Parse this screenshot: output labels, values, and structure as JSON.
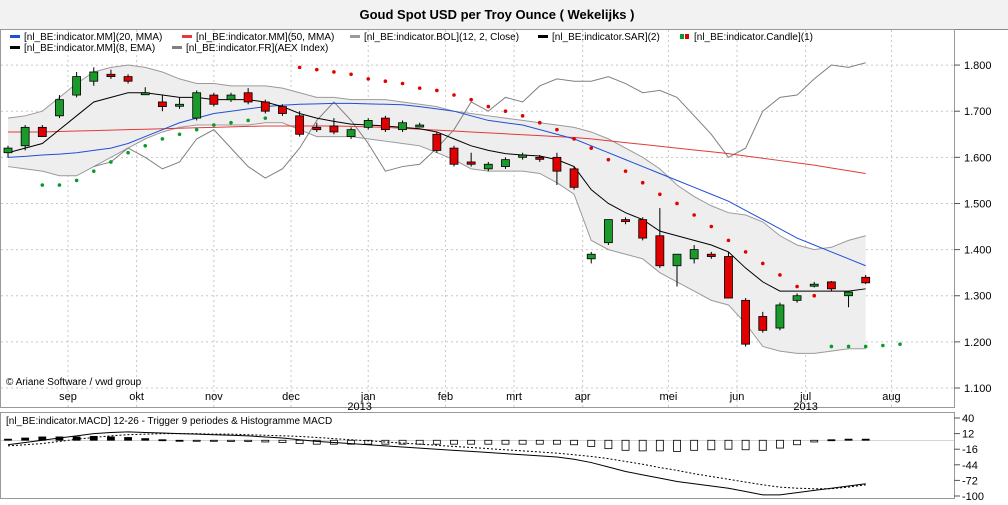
{
  "title": "Goud Spot USD per Troy Ounce  ( Wekelijks )",
  "copyright": "© Ariane Software / vwd group",
  "colors": {
    "ma20": "#1f4fd8",
    "ma50": "#e23b3b",
    "bol": "#9a9a9a",
    "bol_fill": "#eeeeee",
    "ema8": "#000000",
    "aex": "#808080",
    "sar_down": "#e00000",
    "sar_up": "#0a9a2a",
    "candle_up": "#1a9a2a",
    "candle_down": "#e00000",
    "grid": "#c8c8c8",
    "macd_line": "#000000",
    "macd_signal": "#000000"
  },
  "legend": [
    {
      "label": "[nl_BE:indicator.MM](20, MMA)",
      "color": "#1f4fd8",
      "swatch": "line"
    },
    {
      "label": "[nl_BE:indicator.MM](50, MMA)",
      "color": "#e23b3b",
      "swatch": "line"
    },
    {
      "label": "[nl_BE:indicator.BOL](12, 2, Close)",
      "color": "#9a9a9a",
      "swatch": "line"
    },
    {
      "label": "[nl_BE:indicator.SAR](2)",
      "color": "#000000",
      "swatch": "line"
    },
    {
      "label": "[nl_BE:indicator.Candle](1)",
      "color": "#e00000",
      "swatch": "candle"
    },
    {
      "label": "[nl_BE:indicator.MM](8, EMA)",
      "color": "#000000",
      "swatch": "line"
    },
    {
      "label": "[nl_BE:indicator.FR](AEX Index)",
      "color": "#808080",
      "swatch": "line"
    }
  ],
  "chart_data": [
    {
      "type": "candlestick",
      "title": "Goud Spot USD per Troy Ounce  ( Wekelijks )",
      "ylim": [
        1.1,
        1.85
      ],
      "y_ticks": [
        "1.800",
        "1.700",
        "1.600",
        "1.500",
        "1.400",
        "1.300",
        "1.200",
        "1.100"
      ],
      "y_tick_values": [
        1.8,
        1.7,
        1.6,
        1.5,
        1.4,
        1.3,
        1.2,
        1.1
      ],
      "x_labels": [
        "sep",
        "okt",
        "nov",
        "dec",
        "jan",
        "feb",
        "mrt",
        "apr",
        "mei",
        "jun",
        "jul",
        "aug"
      ],
      "x_label_weeks": [
        3.5,
        7.5,
        12,
        16.5,
        21,
        25.5,
        29.5,
        33.5,
        38.5,
        42.5,
        46.5,
        51.5
      ],
      "year_labels": [
        {
          "text": "2013",
          "week": 20.5
        },
        {
          "text": "2013",
          "week": 46.5
        }
      ],
      "weeks": 53,
      "candles": [
        {
          "o": 1.61,
          "h": 1.625,
          "l": 1.6,
          "c": 1.62
        },
        {
          "o": 1.625,
          "h": 1.67,
          "l": 1.615,
          "c": 1.665
        },
        {
          "o": 1.665,
          "h": 1.67,
          "l": 1.645,
          "c": 1.645
        },
        {
          "o": 1.69,
          "h": 1.735,
          "l": 1.685,
          "c": 1.725
        },
        {
          "o": 1.735,
          "h": 1.785,
          "l": 1.73,
          "c": 1.775
        },
        {
          "o": 1.765,
          "h": 1.795,
          "l": 1.755,
          "c": 1.785
        },
        {
          "o": 1.78,
          "h": 1.79,
          "l": 1.77,
          "c": 1.775
        },
        {
          "o": 1.775,
          "h": 1.78,
          "l": 1.76,
          "c": 1.765
        },
        {
          "o": 1.738,
          "h": 1.752,
          "l": 1.735,
          "c": 1.74
        },
        {
          "o": 1.72,
          "h": 1.735,
          "l": 1.7,
          "c": 1.71
        },
        {
          "o": 1.715,
          "h": 1.73,
          "l": 1.705,
          "c": 1.715
        },
        {
          "o": 1.685,
          "h": 1.745,
          "l": 1.68,
          "c": 1.74
        },
        {
          "o": 1.735,
          "h": 1.74,
          "l": 1.71,
          "c": 1.715
        },
        {
          "o": 1.725,
          "h": 1.74,
          "l": 1.72,
          "c": 1.735
        },
        {
          "o": 1.74,
          "h": 1.75,
          "l": 1.715,
          "c": 1.72
        },
        {
          "o": 1.72,
          "h": 1.725,
          "l": 1.695,
          "c": 1.7
        },
        {
          "o": 1.71,
          "h": 1.715,
          "l": 1.69,
          "c": 1.695
        },
        {
          "o": 1.69,
          "h": 1.7,
          "l": 1.645,
          "c": 1.65
        },
        {
          "o": 1.665,
          "h": 1.675,
          "l": 1.655,
          "c": 1.66
        },
        {
          "o": 1.668,
          "h": 1.685,
          "l": 1.65,
          "c": 1.655
        },
        {
          "o": 1.645,
          "h": 1.665,
          "l": 1.64,
          "c": 1.66
        },
        {
          "o": 1.665,
          "h": 1.685,
          "l": 1.66,
          "c": 1.68
        },
        {
          "o": 1.685,
          "h": 1.69,
          "l": 1.655,
          "c": 1.66
        },
        {
          "o": 1.66,
          "h": 1.68,
          "l": 1.655,
          "c": 1.675
        },
        {
          "o": 1.67,
          "h": 1.675,
          "l": 1.665,
          "c": 1.67
        },
        {
          "o": 1.65,
          "h": 1.655,
          "l": 1.61,
          "c": 1.615
        },
        {
          "o": 1.62,
          "h": 1.625,
          "l": 1.58,
          "c": 1.585
        },
        {
          "o": 1.59,
          "h": 1.61,
          "l": 1.58,
          "c": 1.585
        },
        {
          "o": 1.575,
          "h": 1.59,
          "l": 1.57,
          "c": 1.585
        },
        {
          "o": 1.58,
          "h": 1.6,
          "l": 1.575,
          "c": 1.595
        },
        {
          "o": 1.6,
          "h": 1.61,
          "l": 1.595,
          "c": 1.605
        },
        {
          "o": 1.6,
          "h": 1.605,
          "l": 1.59,
          "c": 1.598
        },
        {
          "o": 1.6,
          "h": 1.61,
          "l": 1.54,
          "c": 1.57
        },
        {
          "o": 1.575,
          "h": 1.58,
          "l": 1.53,
          "c": 1.535
        },
        {
          "o": 1.38,
          "h": 1.395,
          "l": 1.37,
          "c": 1.39
        },
        {
          "o": 1.415,
          "h": 1.465,
          "l": 1.41,
          "c": 1.465
        },
        {
          "o": 1.465,
          "h": 1.47,
          "l": 1.455,
          "c": 1.462
        },
        {
          "o": 1.465,
          "h": 1.47,
          "l": 1.42,
          "c": 1.425
        },
        {
          "o": 1.43,
          "h": 1.49,
          "l": 1.36,
          "c": 1.365
        },
        {
          "o": 1.365,
          "h": 1.39,
          "l": 1.32,
          "c": 1.39
        },
        {
          "o": 1.38,
          "h": 1.41,
          "l": 1.37,
          "c": 1.4
        },
        {
          "o": 1.39,
          "h": 1.395,
          "l": 1.38,
          "c": 1.385
        },
        {
          "o": 1.385,
          "h": 1.395,
          "l": 1.3,
          "c": 1.295
        },
        {
          "o": 1.29,
          "h": 1.295,
          "l": 1.19,
          "c": 1.195
        },
        {
          "o": 1.255,
          "h": 1.265,
          "l": 1.22,
          "c": 1.225
        },
        {
          "o": 1.23,
          "h": 1.285,
          "l": 1.225,
          "c": 1.28
        },
        {
          "o": 1.29,
          "h": 1.305,
          "l": 1.285,
          "c": 1.3
        },
        {
          "o": 1.322,
          "h": 1.33,
          "l": 1.318,
          "c": 1.325
        },
        {
          "o": 1.33,
          "h": 1.332,
          "l": 1.31,
          "c": 1.315
        },
        {
          "o": 1.3,
          "h": 1.31,
          "l": 1.275,
          "c": 1.308
        },
        {
          "o": 1.34,
          "h": 1.345,
          "l": 1.325,
          "c": 1.328
        }
      ],
      "ema8": [
        1.61,
        1.62,
        1.63,
        1.66,
        1.69,
        1.72,
        1.73,
        1.74,
        1.74,
        1.735,
        1.73,
        1.73,
        1.725,
        1.725,
        1.725,
        1.72,
        1.71,
        1.695,
        1.685,
        1.678,
        1.672,
        1.67,
        1.668,
        1.665,
        1.662,
        1.655,
        1.64,
        1.625,
        1.615,
        1.608,
        1.605,
        1.603,
        1.595,
        1.58,
        1.53,
        1.5,
        1.48,
        1.465,
        1.44,
        1.43,
        1.42,
        1.41,
        1.395,
        1.36,
        1.33,
        1.31,
        1.31,
        1.31,
        1.31,
        1.31,
        1.315
      ],
      "ma20": [
        1.6,
        1.602,
        1.605,
        1.607,
        1.61,
        1.615,
        1.62,
        1.63,
        1.645,
        1.66,
        1.675,
        1.685,
        1.695,
        1.7,
        1.705,
        1.71,
        1.713,
        1.715,
        1.716,
        1.717,
        1.717,
        1.716,
        1.715,
        1.714,
        1.71,
        1.705,
        1.7,
        1.69,
        1.68,
        1.675,
        1.67,
        1.66,
        1.65,
        1.64,
        1.625,
        1.61,
        1.595,
        1.58,
        1.565,
        1.55,
        1.535,
        1.52,
        1.505,
        1.485,
        1.465,
        1.445,
        1.425,
        1.41,
        1.395,
        1.38,
        1.365
      ],
      "ma50": [
        1.655,
        1.655,
        1.655,
        1.656,
        1.657,
        1.658,
        1.659,
        1.66,
        1.661,
        1.662,
        1.663,
        1.664,
        1.665,
        1.666,
        1.667,
        1.668,
        1.668,
        1.668,
        1.668,
        1.668,
        1.667,
        1.666,
        1.665,
        1.663,
        1.661,
        1.659,
        1.657,
        1.655,
        1.653,
        1.651,
        1.649,
        1.647,
        1.645,
        1.643,
        1.64,
        1.636,
        1.632,
        1.628,
        1.624,
        1.62,
        1.616,
        1.612,
        1.608,
        1.603,
        1.598,
        1.593,
        1.588,
        1.583,
        1.577,
        1.571,
        1.565
      ],
      "bol_upper": [
        1.685,
        1.69,
        1.7,
        1.73,
        1.76,
        1.785,
        1.795,
        1.8,
        1.795,
        1.785,
        1.77,
        1.76,
        1.76,
        1.755,
        1.755,
        1.755,
        1.75,
        1.74,
        1.73,
        1.73,
        1.725,
        1.725,
        1.725,
        1.72,
        1.715,
        1.71,
        1.7,
        1.695,
        1.69,
        1.685,
        1.68,
        1.675,
        1.67,
        1.665,
        1.655,
        1.64,
        1.62,
        1.6,
        1.575,
        1.54,
        1.515,
        1.495,
        1.48,
        1.475,
        1.46,
        1.43,
        1.41,
        1.4,
        1.405,
        1.42,
        1.43
      ],
      "bol_lower": [
        1.58,
        1.575,
        1.57,
        1.56,
        1.56,
        1.58,
        1.6,
        1.62,
        1.64,
        1.655,
        1.665,
        1.67,
        1.67,
        1.67,
        1.67,
        1.675,
        1.675,
        1.66,
        1.645,
        1.645,
        1.645,
        1.64,
        1.635,
        1.63,
        1.625,
        1.61,
        1.595,
        1.575,
        1.57,
        1.57,
        1.57,
        1.565,
        1.545,
        1.52,
        1.42,
        1.4,
        1.39,
        1.38,
        1.35,
        1.33,
        1.31,
        1.29,
        1.28,
        1.24,
        1.19,
        1.18,
        1.175,
        1.175,
        1.18,
        1.185,
        1.185
      ],
      "sar": [
        {
          "i": 2,
          "v": 1.54,
          "dir": "up"
        },
        {
          "i": 3,
          "v": 1.54,
          "dir": "up"
        },
        {
          "i": 4,
          "v": 1.55,
          "dir": "up"
        },
        {
          "i": 5,
          "v": 1.57,
          "dir": "up"
        },
        {
          "i": 6,
          "v": 1.59,
          "dir": "up"
        },
        {
          "i": 7,
          "v": 1.61,
          "dir": "up"
        },
        {
          "i": 8,
          "v": 1.625,
          "dir": "up"
        },
        {
          "i": 9,
          "v": 1.64,
          "dir": "up"
        },
        {
          "i": 10,
          "v": 1.65,
          "dir": "up"
        },
        {
          "i": 11,
          "v": 1.66,
          "dir": "up"
        },
        {
          "i": 12,
          "v": 1.67,
          "dir": "up"
        },
        {
          "i": 13,
          "v": 1.675,
          "dir": "up"
        },
        {
          "i": 14,
          "v": 1.68,
          "dir": "up"
        },
        {
          "i": 15,
          "v": 1.685,
          "dir": "up"
        },
        {
          "i": 17,
          "v": 1.795,
          "dir": "down"
        },
        {
          "i": 18,
          "v": 1.79,
          "dir": "down"
        },
        {
          "i": 19,
          "v": 1.785,
          "dir": "down"
        },
        {
          "i": 20,
          "v": 1.78,
          "dir": "down"
        },
        {
          "i": 21,
          "v": 1.77,
          "dir": "down"
        },
        {
          "i": 22,
          "v": 1.765,
          "dir": "down"
        },
        {
          "i": 23,
          "v": 1.76,
          "dir": "down"
        },
        {
          "i": 24,
          "v": 1.75,
          "dir": "down"
        },
        {
          "i": 25,
          "v": 1.745,
          "dir": "down"
        },
        {
          "i": 26,
          "v": 1.735,
          "dir": "down"
        },
        {
          "i": 27,
          "v": 1.725,
          "dir": "down"
        },
        {
          "i": 28,
          "v": 1.71,
          "dir": "down"
        },
        {
          "i": 29,
          "v": 1.7,
          "dir": "down"
        },
        {
          "i": 30,
          "v": 1.69,
          "dir": "down"
        },
        {
          "i": 31,
          "v": 1.675,
          "dir": "down"
        },
        {
          "i": 32,
          "v": 1.66,
          "dir": "down"
        },
        {
          "i": 33,
          "v": 1.64,
          "dir": "down"
        },
        {
          "i": 34,
          "v": 1.62,
          "dir": "down"
        },
        {
          "i": 35,
          "v": 1.595,
          "dir": "down"
        },
        {
          "i": 36,
          "v": 1.57,
          "dir": "down"
        },
        {
          "i": 37,
          "v": 1.545,
          "dir": "down"
        },
        {
          "i": 38,
          "v": 1.52,
          "dir": "down"
        },
        {
          "i": 39,
          "v": 1.5,
          "dir": "down"
        },
        {
          "i": 40,
          "v": 1.475,
          "dir": "down"
        },
        {
          "i": 41,
          "v": 1.45,
          "dir": "down"
        },
        {
          "i": 42,
          "v": 1.42,
          "dir": "down"
        },
        {
          "i": 43,
          "v": 1.395,
          "dir": "down"
        },
        {
          "i": 44,
          "v": 1.37,
          "dir": "down"
        },
        {
          "i": 45,
          "v": 1.345,
          "dir": "down"
        },
        {
          "i": 46,
          "v": 1.32,
          "dir": "down"
        },
        {
          "i": 47,
          "v": 1.3,
          "dir": "down"
        },
        {
          "i": 48,
          "v": 1.19,
          "dir": "up"
        },
        {
          "i": 49,
          "v": 1.19,
          "dir": "up"
        },
        {
          "i": 50,
          "v": 1.19,
          "dir": "up"
        },
        {
          "i": 51,
          "v": 1.192,
          "dir": "up"
        },
        {
          "i": 52,
          "v": 1.195,
          "dir": "up"
        }
      ],
      "aex_plotted": [
        1.58,
        1.59,
        1.62,
        1.6,
        1.575,
        1.59,
        1.64,
        1.66,
        1.62,
        1.58,
        1.555,
        1.575,
        1.62,
        1.68,
        1.72,
        1.68,
        1.63,
        1.57,
        1.58,
        1.585,
        1.62,
        1.66,
        1.72,
        1.7,
        1.73,
        1.72,
        1.755,
        1.77,
        1.765,
        1.765,
        1.775,
        1.76,
        1.74,
        1.745,
        1.73,
        1.69,
        1.65,
        1.6,
        1.62,
        1.7,
        1.73,
        1.735,
        1.77,
        1.8,
        1.795,
        1.805
      ]
    },
    {
      "type": "macd",
      "title": "[nl_BE:indicator.MACD] 12-26 - Trigger 9 periodes & Histogramme MACD",
      "ylim": [
        -100,
        40
      ],
      "y_ticks": [
        "40",
        "12",
        "-16",
        "-44",
        "-72",
        "-100"
      ],
      "y_tick_values": [
        40,
        12,
        -16,
        -44,
        -72,
        -100
      ],
      "macd": [
        -8,
        -4,
        0,
        4,
        8,
        12,
        14,
        15,
        14,
        13,
        12,
        11,
        10,
        9,
        8,
        6,
        4,
        1,
        -2,
        -4,
        -6,
        -8,
        -10,
        -12,
        -14,
        -16,
        -18,
        -20,
        -22,
        -24,
        -26,
        -28,
        -30,
        -34,
        -40,
        -48,
        -56,
        -62,
        -68,
        -74,
        -78,
        -82,
        -86,
        -92,
        -98,
        -98,
        -94,
        -90,
        -86,
        -82,
        -78
      ],
      "signal": [
        -10,
        -8,
        -6,
        -2,
        2,
        5,
        8,
        10,
        11,
        12,
        12,
        12,
        11,
        11,
        10,
        9,
        8,
        7,
        5,
        3,
        1,
        -1,
        -3,
        -5,
        -7,
        -9,
        -11,
        -13,
        -15,
        -17,
        -19,
        -21,
        -23,
        -26,
        -29,
        -33,
        -38,
        -43,
        -49,
        -54,
        -60,
        -65,
        -70,
        -75,
        -80,
        -84,
        -86,
        -87,
        -87,
        -84,
        -80
      ],
      "histogram": [
        2,
        4,
        6,
        6,
        6,
        7,
        6,
        5,
        3,
        1,
        0,
        -1,
        -1,
        -2,
        -2,
        -3,
        -4,
        -6,
        -7,
        -7,
        -7,
        -7,
        -7,
        -7,
        -7,
        -7,
        -7,
        -7,
        -7,
        -7,
        -7,
        -7,
        -7,
        -8,
        -11,
        -15,
        -18,
        -19,
        -19,
        -20,
        -18,
        -17,
        -16,
        -17,
        -18,
        -14,
        -8,
        -3,
        1,
        2,
        2
      ]
    }
  ]
}
